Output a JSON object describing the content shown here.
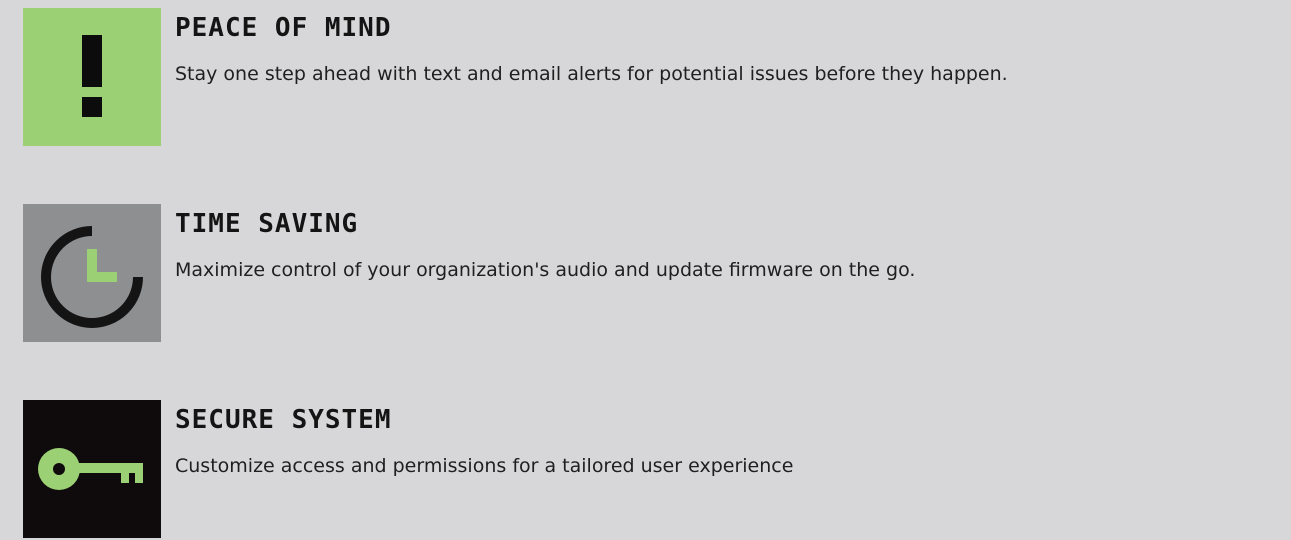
{
  "colors": {
    "background": "#d7d7d9",
    "accent_green": "#9bd174",
    "tile_gray": "#8e8f91",
    "tile_black": "#0f0b0c",
    "text_dark": "#1a1a1a"
  },
  "features": [
    {
      "title": "PEACE OF MIND",
      "description": "Stay one step ahead with text and email alerts for potential issues before they happen.",
      "icon": "exclamation-icon"
    },
    {
      "title": "TIME SAVING",
      "description": "Maximize control of your organization's audio and update firmware on the go.",
      "icon": "clock-icon"
    },
    {
      "title": "SECURE SYSTEM",
      "description": "Customize access and permissions for a tailored user experience",
      "icon": "key-icon"
    }
  ]
}
